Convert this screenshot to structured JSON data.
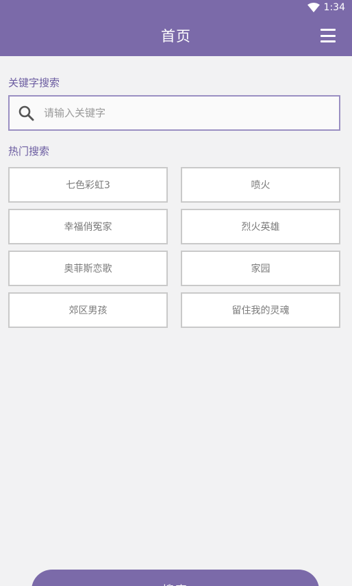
{
  "status_bar": {
    "time": "1:34",
    "icon": "wifi-icon"
  },
  "header": {
    "title": "首页",
    "menu_icon": "hamburger-menu-icon"
  },
  "search": {
    "label": "关键字搜索",
    "placeholder": "请输入关键字",
    "value": "",
    "icon": "search-icon"
  },
  "hot": {
    "label": "热门搜索",
    "items": [
      {
        "label": "七色彩虹3"
      },
      {
        "label": "喷火"
      },
      {
        "label": "幸福俏冤家"
      },
      {
        "label": "烈火英雄"
      },
      {
        "label": "奥菲斯恋歌"
      },
      {
        "label": "家园"
      },
      {
        "label": "郊区男孩"
      },
      {
        "label": "留住我的灵魂"
      }
    ]
  },
  "actions": {
    "search_label": "搜索"
  },
  "colors": {
    "primary": "#7b6aa9",
    "border": "#9a8fc2",
    "background": "#f2f2f3"
  }
}
